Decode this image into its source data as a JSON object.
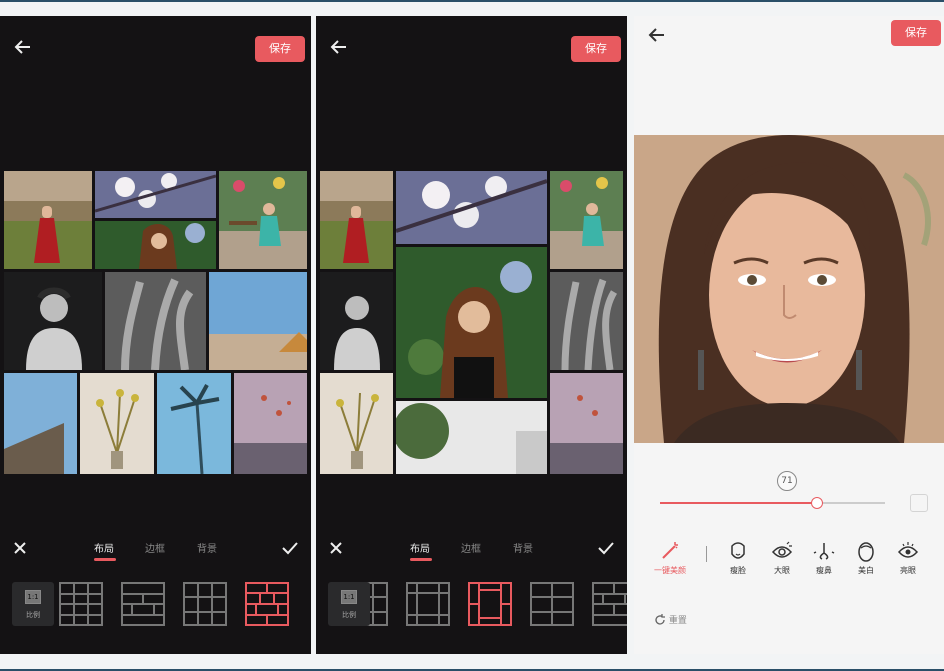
{
  "screens": [
    {
      "save_label": "保存",
      "tabs": [
        {
          "label": "布局"
        },
        {
          "label": "边框"
        },
        {
          "label": "背景"
        }
      ],
      "active_tab": "布局",
      "ratio_box": "1:1",
      "ratio_label": "比例",
      "selected_layout_index": 3
    },
    {
      "save_label": "保存",
      "tabs": [
        {
          "label": "布局"
        },
        {
          "label": "边框"
        },
        {
          "label": "背景"
        }
      ],
      "active_tab": "布局",
      "ratio_box": "1:1",
      "ratio_label": "比例",
      "selected_layout_index": 2
    },
    {
      "save_label": "保存",
      "slider_value": "71",
      "slider_fraction": 0.71,
      "tools": [
        {
          "label": "一键美颜",
          "icon": "magic-wand-icon",
          "active": true
        },
        {
          "label": "瘦脸",
          "icon": "face-icon"
        },
        {
          "label": "大眼",
          "icon": "eye-icon"
        },
        {
          "label": "瘦鼻",
          "icon": "nose-icon"
        },
        {
          "label": "美白",
          "icon": "whiten-icon"
        },
        {
          "label": "亮眼",
          "icon": "bright-eye-icon"
        }
      ],
      "reset_label": "重置"
    }
  ],
  "colors": {
    "accent": "#e85a5f",
    "dark_bg": "#141214"
  }
}
